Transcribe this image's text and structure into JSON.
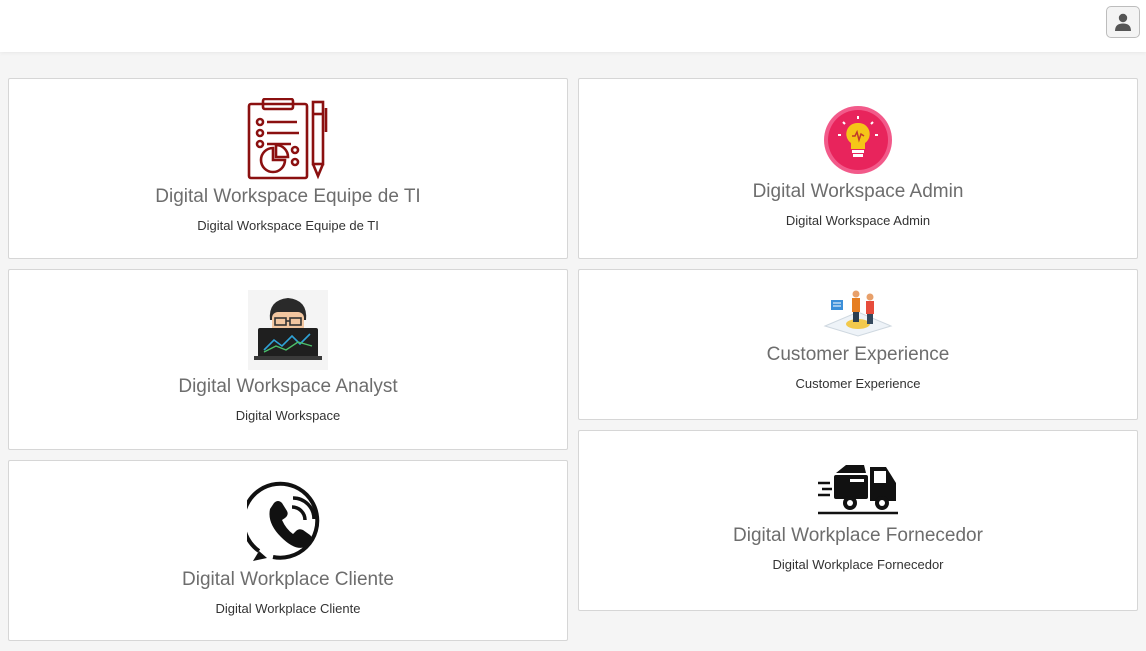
{
  "header": {
    "user_icon": "user-icon"
  },
  "left_cards": [
    {
      "title": "Digital Workspace Equipe de TI",
      "subtitle": "Digital Workspace Equipe de TI",
      "icon": "clipboard-report-icon"
    },
    {
      "title": "Digital Workspace Analyst",
      "subtitle": "Digital Workspace",
      "icon": "analyst-laptop-icon"
    },
    {
      "title": "Digital Workplace Cliente",
      "subtitle": "Digital Workplace Cliente",
      "icon": "phone-call-icon"
    }
  ],
  "right_cards": [
    {
      "title": "Digital Workspace Admin",
      "subtitle": "Digital Workspace Admin",
      "icon": "lightbulb-icon"
    },
    {
      "title": "Customer Experience",
      "subtitle": "Customer Experience",
      "icon": "customer-team-icon"
    },
    {
      "title": "Digital Workplace Fornecedor",
      "subtitle": "Digital Workplace Fornecedor",
      "icon": "delivery-truck-icon"
    }
  ],
  "colors": {
    "clipboard": "#8b1010",
    "lightbulb_bg": "#e8245c",
    "lightbulb": "#f5c518"
  }
}
